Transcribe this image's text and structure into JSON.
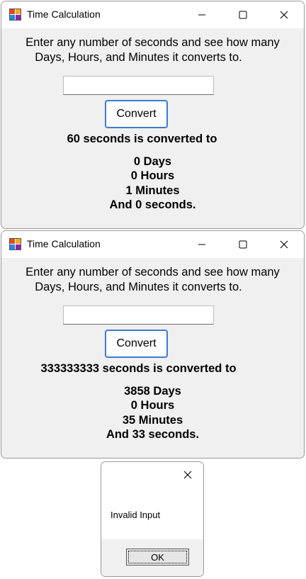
{
  "windows": [
    {
      "title": "Time Calculation",
      "instructions_line1": "Enter any number of seconds and see how many",
      "instructions_line2": "Days, Hours, and Minutes it converts to.",
      "input_value": "",
      "convert_label": "Convert",
      "headline": "60 seconds is converted to",
      "result": {
        "days": "0 Days",
        "hours": "0 Hours",
        "minutes": "1 Minutes",
        "seconds": "And 0 seconds."
      }
    },
    {
      "title": "Time Calculation",
      "instructions_line1": "Enter any number of seconds and see how many",
      "instructions_line2": "Days, Hours, and Minutes it converts to.",
      "input_value": "",
      "convert_label": "Convert",
      "headline": "333333333 seconds is converted to",
      "result": {
        "days": "3858 Days",
        "hours": "0 Hours",
        "minutes": "35 Minutes",
        "seconds": "And 33 seconds."
      }
    }
  ],
  "dialog": {
    "message": "Invalid Input",
    "ok_label": "OK"
  },
  "colors": {
    "window_bg": "#f0f0f0",
    "titlebar_bg": "#ffffff",
    "accent_border": "#3e7bd1"
  }
}
